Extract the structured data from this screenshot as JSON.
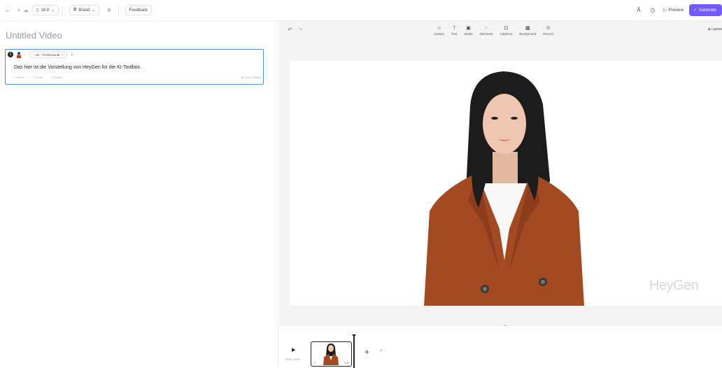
{
  "topbar": {
    "aspect_label": "16:9",
    "brand_label": "Brand",
    "feedback_label": "Feedback",
    "preview_label": "Preview",
    "generate_label": "Generate"
  },
  "left": {
    "video_title": "Untitled Video",
    "scene": {
      "number": "1",
      "voice_label": "Jin - Professional",
      "script_text": "Das hier ist die Vorstellung von HeyGen für die KI-Toolbox.",
      "footer": {
        "scene": "Scene",
        "audio": "Audio",
        "pause": "Pause",
        "voice_director": "Voice Director"
      }
    }
  },
  "canvas_toolbar": {
    "tools": [
      {
        "label": "Avatars",
        "icon": "avatar-icon"
      },
      {
        "label": "Text",
        "icon": "text-icon"
      },
      {
        "label": "Media",
        "icon": "media-icon"
      },
      {
        "label": "Elements",
        "icon": "elements-icon"
      },
      {
        "label": "Captions",
        "icon": "captions-icon"
      },
      {
        "label": "Background",
        "icon": "background-icon"
      },
      {
        "label": "Record",
        "icon": "record-icon"
      }
    ],
    "layers_label": "Layers"
  },
  "canvas": {
    "watermark": "HeyGen"
  },
  "timeline": {
    "time": "00:00 / 00:04",
    "scene_number": "1",
    "scene_duration": "4.0s"
  },
  "colors": {
    "accent": "#7559ff",
    "selection": "#4a8de0",
    "jacket": "#a34a22"
  }
}
